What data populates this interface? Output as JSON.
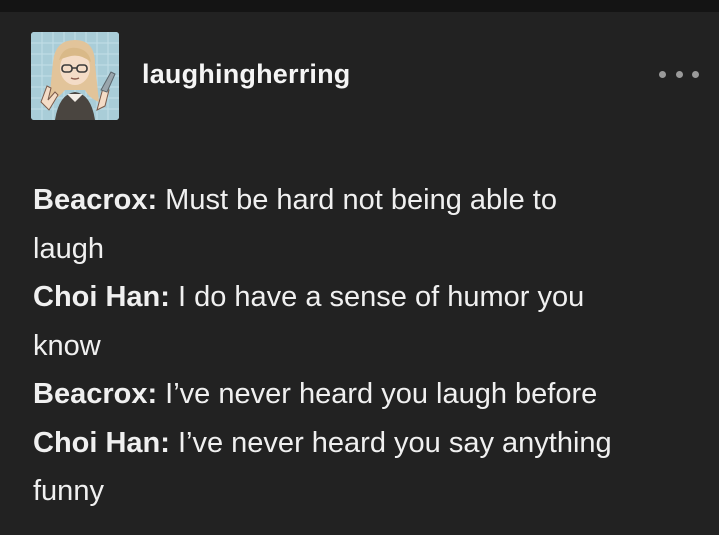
{
  "post": {
    "username": "laughingherring",
    "more_icon": "ellipsis-icon",
    "avatar_icon": "avatar-illustration",
    "dialogue": [
      {
        "speaker": "Beacrox:",
        "text": " Must be hard not being able to"
      },
      {
        "speaker": "",
        "text": "laugh"
      },
      {
        "speaker": "Choi Han:",
        "text": " I do have a sense of humor you"
      },
      {
        "speaker": "",
        "text": "know"
      },
      {
        "speaker": "Beacrox:",
        "text": " I’ve never heard you laugh before"
      },
      {
        "speaker": "Choi Han:",
        "text": " I’ve never heard you say anything"
      },
      {
        "speaker": "",
        "text": "funny"
      }
    ]
  },
  "colors": {
    "background": "#222222",
    "text": "#f0f0f0",
    "avatar_bg": "#a9cdd8"
  }
}
